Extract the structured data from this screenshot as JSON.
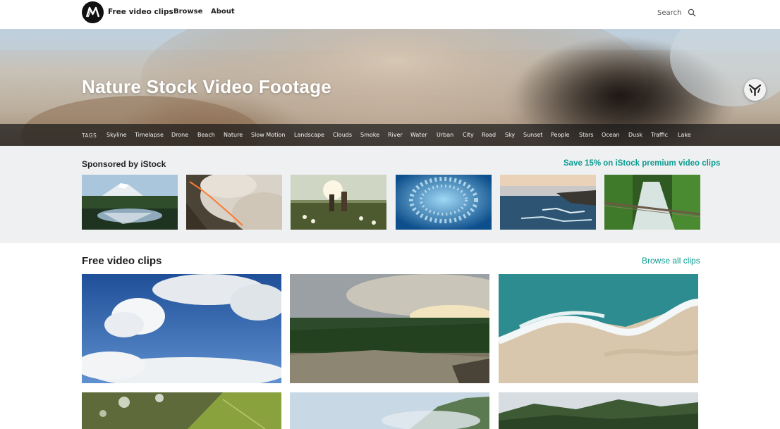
{
  "header": {
    "brand": "Free video clips",
    "nav": {
      "browse": "Browse",
      "about": "About"
    },
    "search_placeholder": "Search"
  },
  "hero": {
    "title": "Nature Stock Video Footage"
  },
  "tags": {
    "label": "TAGS",
    "items": [
      "Skyline",
      "Timelapse",
      "Drone",
      "Beach",
      "Nature",
      "Slow Motion",
      "Landscape",
      "Clouds",
      "Smoke",
      "River",
      "Water",
      "Urban",
      "City",
      "Road",
      "Sky",
      "Sunset",
      "People",
      "Stars",
      "Ocean",
      "Dusk",
      "Traffic",
      "Lake"
    ]
  },
  "sponsored": {
    "title": "Sponsored by iStock",
    "promo": "Save 15% on iStock premium video clips"
  },
  "clips": {
    "title": "Free video clips",
    "browse_all": "Browse all clips"
  },
  "colors": {
    "accent": "#0c9c91",
    "tagbar": "#191919",
    "sponsored_bg": "#eef0f2"
  },
  "icons": {
    "logo": "brand-logo-icon",
    "search": "search-icon",
    "badge": "istock-badge-icon"
  }
}
